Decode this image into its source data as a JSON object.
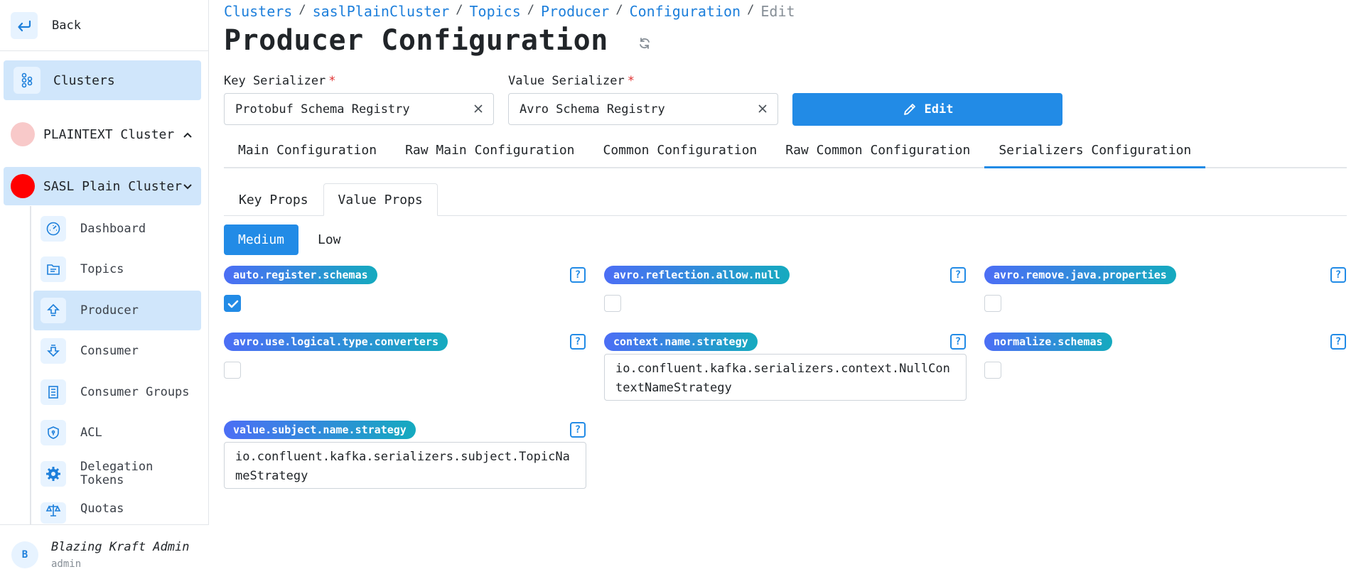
{
  "sidebar": {
    "back_label": "Back",
    "clusters_label": "Clusters",
    "clusters": [
      {
        "label": "PLAINTEXT Cluster",
        "color": "#f8c9c9",
        "expanded": false
      },
      {
        "label": "SASL Plain Cluster",
        "color": "#ff0000",
        "expanded": true
      }
    ],
    "items": [
      {
        "label": "Dashboard",
        "icon": "gauge-icon"
      },
      {
        "label": "Topics",
        "icon": "folder-icon"
      },
      {
        "label": "Producer",
        "icon": "upload-icon"
      },
      {
        "label": "Consumer",
        "icon": "download-icon"
      },
      {
        "label": "Consumer Groups",
        "icon": "group-icon"
      },
      {
        "label": "ACL",
        "icon": "shield-icon"
      },
      {
        "label": "Delegation Tokens",
        "icon": "gear-icon"
      },
      {
        "label": "Quotas",
        "icon": "scale-icon"
      }
    ],
    "user": {
      "initial": "B",
      "name": "Blazing Kraft Admin",
      "role": "admin"
    }
  },
  "breadcrumb": {
    "items": [
      "Clusters",
      "saslPlainCluster",
      "Topics",
      "Producer",
      "Configuration"
    ],
    "separator": "/",
    "current": "Edit"
  },
  "page": {
    "title": "Producer Configuration"
  },
  "form": {
    "key_serializer": {
      "label": "Key Serializer",
      "required_mark": "*",
      "value": "Protobuf Schema Registry"
    },
    "value_serializer": {
      "label": "Value Serializer",
      "required_mark": "*",
      "value": "Avro Schema Registry"
    },
    "edit_label": "Edit"
  },
  "tabs": {
    "main": [
      "Main Configuration",
      "Raw Main Configuration",
      "Common Configuration",
      "Raw Common Configuration",
      "Serializers Configuration"
    ],
    "main_active": "Serializers Configuration",
    "sub": [
      "Key Props",
      "Value Props"
    ],
    "sub_active": "Value Props",
    "importance": [
      "Medium",
      "Low"
    ],
    "importance_active": "Medium"
  },
  "props": [
    {
      "name": "auto.register.schemas",
      "type": "boolean",
      "checked": true
    },
    {
      "name": "avro.reflection.allow.null",
      "type": "boolean",
      "checked": false
    },
    {
      "name": "avro.remove.java.properties",
      "type": "boolean",
      "checked": false
    },
    {
      "name": "avro.use.logical.type.converters",
      "type": "boolean",
      "checked": false
    },
    {
      "name": "context.name.strategy",
      "type": "text",
      "value": "io.confluent.kafka.serializers.context.NullContextNameStrategy"
    },
    {
      "name": "normalize.schemas",
      "type": "boolean",
      "checked": false
    },
    {
      "name": "value.subject.name.strategy",
      "type": "text",
      "value": "io.confluent.kafka.serializers.subject.TopicNameStrategy"
    }
  ],
  "help_glyph": "?",
  "colors": {
    "accent": "#228be6",
    "active_bg": "#d0e6fb",
    "badge_gradient_start": "#4c6ef5",
    "badge_gradient_end": "#15aabf",
    "required": "#e03131"
  }
}
